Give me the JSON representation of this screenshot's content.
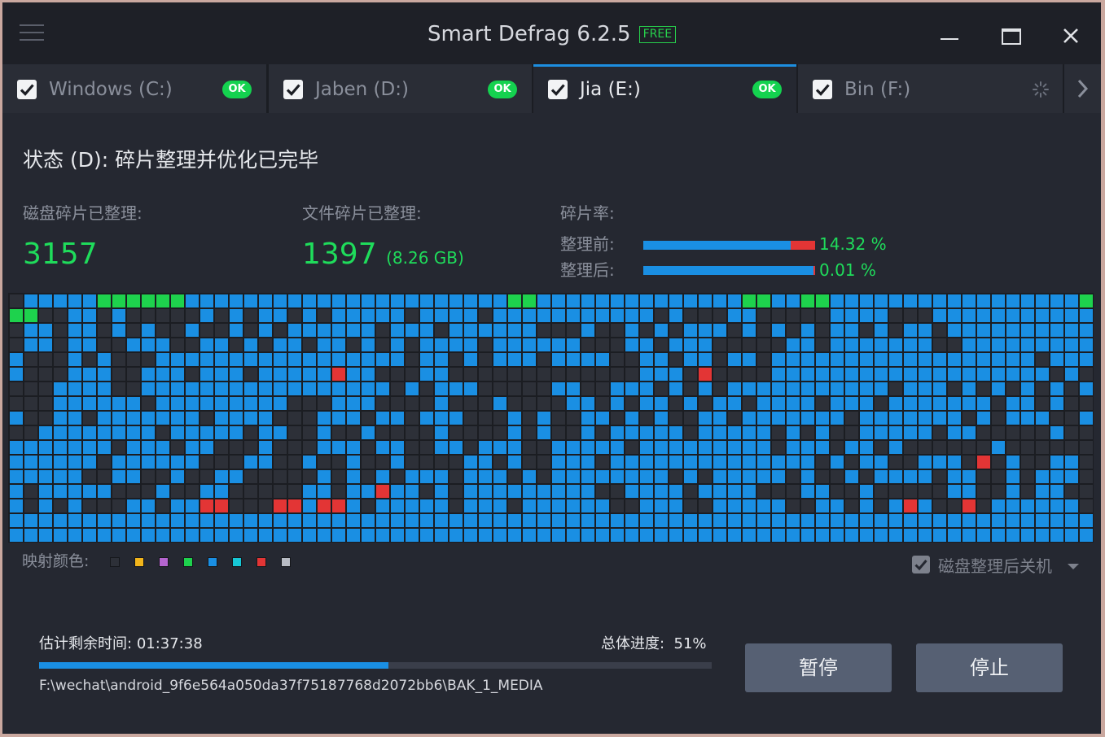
{
  "app": {
    "title": "Smart Defrag 6.2.5",
    "badge": "FREE"
  },
  "colors": {
    "ok_green": "#14d24f",
    "accent_blue": "#1a8fe3",
    "fragment_red": "#e33535",
    "text_green": "#1fdc5b"
  },
  "tabs": [
    {
      "label": "Windows (C:)",
      "checked": true,
      "status": "OK",
      "active": false
    },
    {
      "label": "Jaben (D:)",
      "checked": true,
      "status": "OK",
      "active": false
    },
    {
      "label": "Jia (E:)",
      "checked": true,
      "status": "OK",
      "active": true
    },
    {
      "label": "Bin (F:)",
      "checked": true,
      "status": "spinner-icon",
      "active": false
    }
  ],
  "status": {
    "line": "状态 (D): 碎片整理并优化已完毕"
  },
  "stats": {
    "disk_fragments_label": "磁盘碎片已整理:",
    "disk_fragments_value": "3157",
    "file_fragments_label": "文件碎片已整理:",
    "file_fragments_value": "1397",
    "file_fragments_size": "(8.26 GB)",
    "frag_rate_label": "碎片率:",
    "before_label": "整理前:",
    "before_value": "14.32 %",
    "before_fraction": 0.1432,
    "after_label": "整理后:",
    "after_value": "0.01 %",
    "after_fraction": 0.0001
  },
  "map": {
    "legend_label": "映射颜色:",
    "legend_colors": [
      "#2d3038",
      "#f2b51b",
      "#b565cf",
      "#1ed24d",
      "#1a8fe3",
      "#17c8d6",
      "#e33535",
      "#b8bcc4"
    ],
    "cell_colors": {
      "empty": "#2d3038",
      "used": "#1a8fe3",
      "optimized": "#1ed24d",
      "fragmented": "#e33535"
    }
  },
  "shutdown": {
    "label": "磁盘整理后关机",
    "checked": true
  },
  "progress": {
    "remaining_label": "估计剩余时间:",
    "remaining_value": "01:37:38",
    "overall_label": "总体进度:",
    "overall_value": "51%",
    "percent": 0.51,
    "current_file": "F:\\wechat\\android_9f6e564a050da37f75187768d2072bb6\\BAK_1_MEDIA"
  },
  "actions": {
    "pause_label": "暂停",
    "stop_label": "停止"
  }
}
